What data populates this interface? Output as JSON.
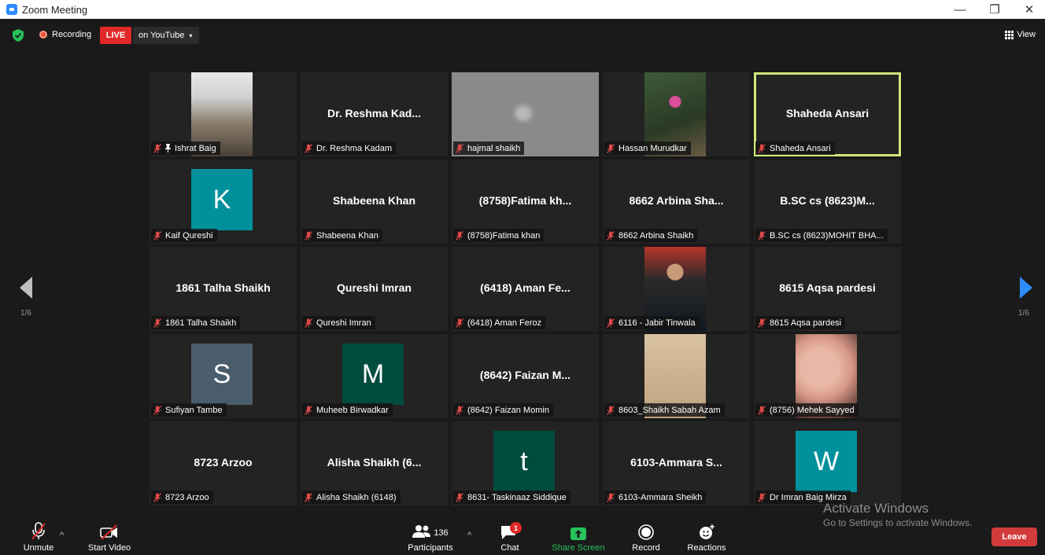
{
  "window": {
    "title": "Zoom Meeting",
    "minimize": "—",
    "maximize": "❐",
    "close": "✕"
  },
  "topbar": {
    "recording_label": "Recording",
    "live_badge": "LIVE",
    "stream_label": "on YouTube",
    "caret": "▾",
    "view_label": "View"
  },
  "pagination": {
    "left_page": "1/6",
    "right_page": "1/6"
  },
  "colors": {
    "avatar_blue": "#00919c",
    "avatar_slate": "#4a5d6b",
    "avatar_dark_green": "#004b3e",
    "active_speaker_border": "#cfe87a",
    "live_red": "#e02828",
    "leave_red": "#d13b3b",
    "share_green": "#26c25a"
  },
  "tiles": [
    {
      "label": "Ishrat Baig",
      "pinned": true,
      "kind": "photo"
    },
    {
      "label": "Dr. Reshma Kadam",
      "center": "Dr. Reshma Kad..."
    },
    {
      "label": "hajmal shaikh",
      "kind": "blurred"
    },
    {
      "label": "Hassan Murudkar",
      "kind": "photo"
    },
    {
      "label": "Shaheda Ansari",
      "center": "Shaheda Ansari",
      "active": true
    },
    {
      "label": "Kaif Qureshi",
      "avatar": "K"
    },
    {
      "label": "Shabeena Khan",
      "center": "Shabeena Khan"
    },
    {
      "label": "(8758)Fatima khan",
      "center": "(8758)Fatima kh..."
    },
    {
      "label": "8662 Arbina Shaikh",
      "center": "8662 Arbina Sha..."
    },
    {
      "label": "B.SC cs (8623)MOHIT BHA...",
      "center": "B.SC cs (8623)M..."
    },
    {
      "label": "1861 Talha Shaikh",
      "center": "1861 Talha Shaikh"
    },
    {
      "label": "Qureshi Imran",
      "center": "Qureshi Imran"
    },
    {
      "label": "(6418) Aman Feroz",
      "center": "(6418) Aman Fe..."
    },
    {
      "label": "6116 - Jabir Tinwala",
      "kind": "photo"
    },
    {
      "label": "8615 Aqsa pardesi",
      "center": "8615 Aqsa pardesi"
    },
    {
      "label": "Sufiyan Tambe",
      "avatar": "S"
    },
    {
      "label": "Muheeb Birwadkar",
      "avatar": "M"
    },
    {
      "label": "(8642) Faizan Momin",
      "center": "(8642) Faizan M..."
    },
    {
      "label": "8603_Shaikh Sabah Azam",
      "kind": "photo"
    },
    {
      "label": "(8756) Mehek Sayyed",
      "kind": "photo"
    },
    {
      "label": "8723 Arzoo",
      "center": "8723 Arzoo"
    },
    {
      "label": "Alisha Shaikh (6148)",
      "center": "Alisha Shaikh (6..."
    },
    {
      "label": "8631- Taskinaaz Siddique",
      "avatar": "t"
    },
    {
      "label": "6103-Ammara Sheikh",
      "center": "6103-Ammara S..."
    },
    {
      "label": "Dr Imran Baig Mirza",
      "avatar": "W"
    }
  ],
  "toolbar": {
    "unmute": "Unmute",
    "start_video": "Start Video",
    "participants": "Participants",
    "participants_count": "136",
    "chat": "Chat",
    "chat_badge": "1",
    "share_screen": "Share Screen",
    "record": "Record",
    "reactions": "Reactions",
    "leave": "Leave",
    "caret_up": "^"
  },
  "watermark": {
    "line1": "Activate Windows",
    "line2": "Go to Settings to activate Windows."
  }
}
